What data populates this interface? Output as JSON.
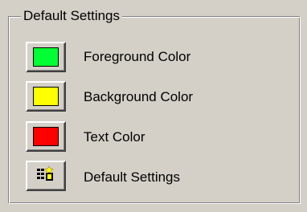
{
  "group": {
    "title": "Default Settings"
  },
  "rows": [
    {
      "label": "Foreground Color",
      "color": "#00ff33"
    },
    {
      "label": "Background Color",
      "color": "#ffff00"
    },
    {
      "label": "Text Color",
      "color": "#ff0000"
    },
    {
      "label": "Default Settings",
      "icon": "default-settings-icon"
    }
  ]
}
